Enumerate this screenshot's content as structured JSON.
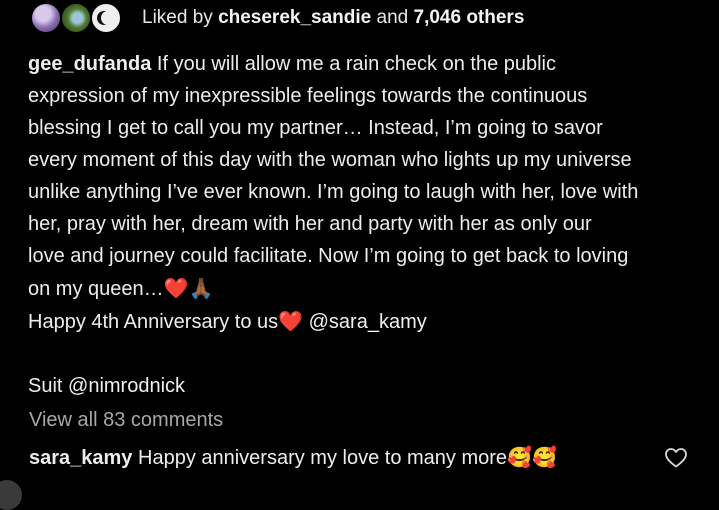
{
  "likes": {
    "prefix": "Liked by",
    "first_user": "cheserek_sandie",
    "connector": "and",
    "others": "7,046 others"
  },
  "caption": {
    "username": "gee_dufanda",
    "lines": [
      "If you will allow me a rain check on the public",
      "expression of my inexpressible feelings towards the continuous",
      "blessing I get to call you my partner… Instead, I’m going to savor",
      "every moment of this day with the woman who lights up my universe",
      "unlike anything I’ve ever known. I’m going to laugh with her, love with",
      "her, pray with her, dream with her and party with her as only our",
      "love and journey could facilitate. Now I’m going to get back to loving",
      "on my queen…"
    ],
    "line8_emojis": [
      "❤️",
      "🙏🏾"
    ],
    "anniversary_text": "Happy 4th Anniversary to us",
    "anniversary_heart": "❤️",
    "anniversary_mention": "@sara_kamy",
    "suit_label": "Suit",
    "suit_mention": "@nimrodnick"
  },
  "comments": {
    "view_all": "View all 83 comments",
    "top_comment": {
      "username": "sara_kamy",
      "text": "Happy anniversary my love to many more",
      "emojis": "🥰🥰"
    }
  },
  "icons": {
    "like_comment": "heart-outline-icon"
  },
  "colors": {
    "background": "#000000",
    "text": "#ededed",
    "muted": "#a8a8a8",
    "heart": "#e8212b"
  }
}
